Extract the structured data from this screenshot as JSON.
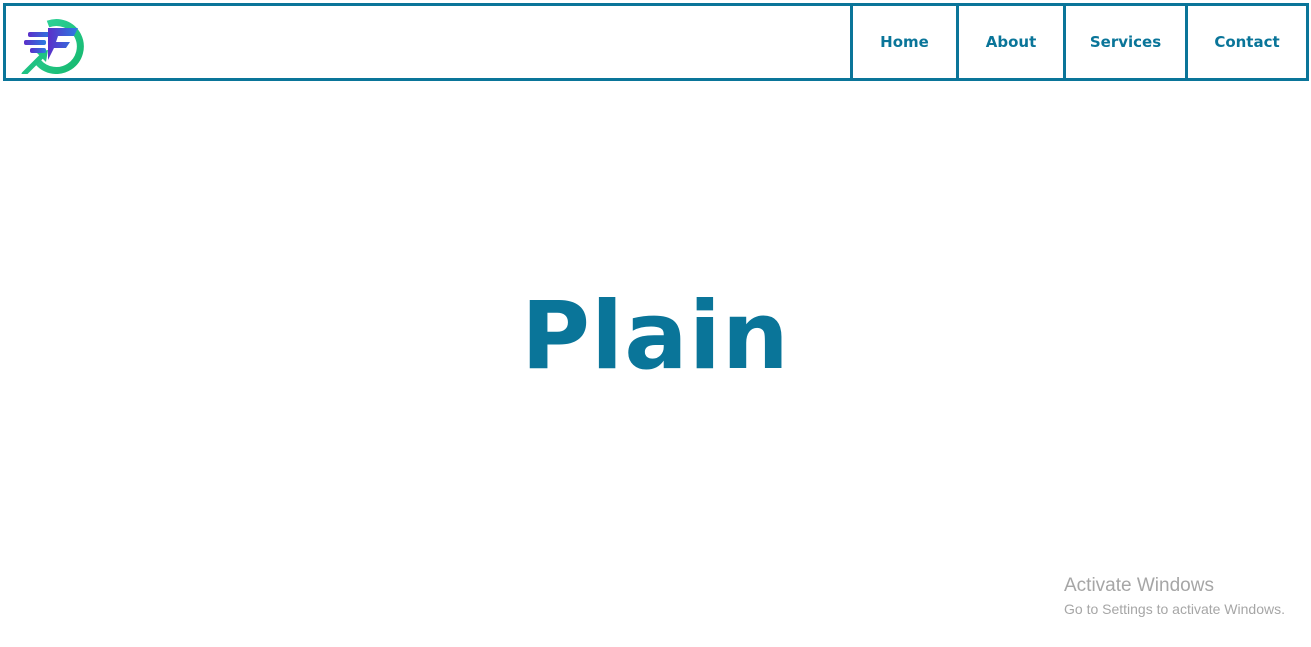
{
  "brand": {
    "logo_icon": "speed-arrow-logo-icon",
    "colors": {
      "primary": "#0a7599",
      "logo_green": "#22c77a",
      "logo_purple": "#4b3bd1"
    }
  },
  "nav": {
    "items": [
      {
        "label": "Home"
      },
      {
        "label": "About"
      },
      {
        "label": "Services"
      },
      {
        "label": "Contact"
      }
    ]
  },
  "hero": {
    "title": "Plain"
  },
  "os_watermark": {
    "title": "Activate Windows",
    "subtitle": "Go to Settings to activate Windows."
  }
}
